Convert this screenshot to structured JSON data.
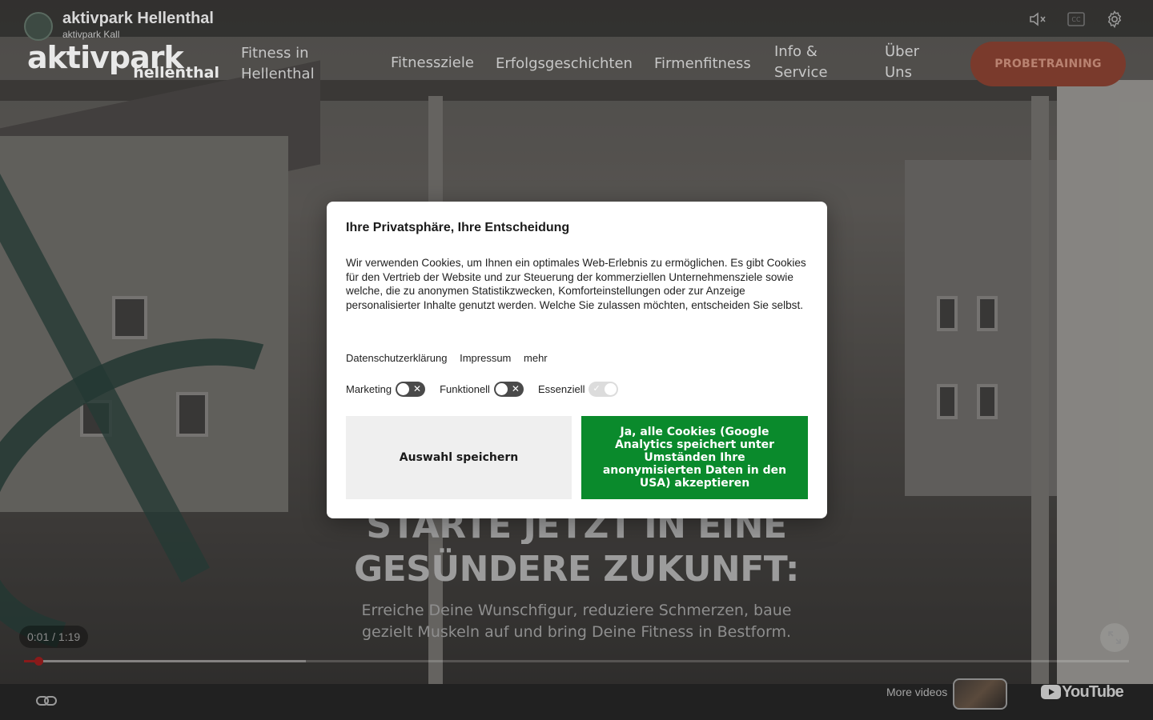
{
  "youtube": {
    "video_title": "aktivpark Hellenthal",
    "channel_name": "aktivpark Kall",
    "time_current": "0:01",
    "time_separator": "/",
    "time_total": "1:19",
    "progress_fraction": 0.013,
    "buffered_fraction": 0.255,
    "more_videos_label": "More videos",
    "logo_text": "YouTube",
    "icons": [
      "mute-icon",
      "captions-icon",
      "settings-icon",
      "expand-icon",
      "link-icon",
      "youtube-logo-icon"
    ]
  },
  "site": {
    "logo_main": "aktivpark",
    "logo_sub": "hellenthal",
    "nav": [
      {
        "line1": "Fitness in",
        "line2": "Hellenthal"
      },
      {
        "line1": "Fitnessziele",
        "line2": ""
      },
      {
        "line1": "Erfolgsgeschichten",
        "line2": ""
      },
      {
        "line1": "Firmenfitness",
        "line2": ""
      },
      {
        "line1": "Info &",
        "line2": "Service"
      },
      {
        "line1": "Über",
        "line2": "Uns"
      }
    ],
    "cta_label": "PROBETRAINING",
    "hero_line1": "STARTE JETZT IN EINE",
    "hero_line2": "GESÜNDERE ZUKUNFT:",
    "hero_subtitle": "Erreiche Deine Wunschfigur, reduziere Schmerzen, baue gezielt Muskeln auf und bring Deine Fitness in Bestform.",
    "colors": {
      "cta_bg": "#7a3a2c",
      "cta_text": "#b98271"
    }
  },
  "cookie": {
    "title": "Ihre Privatsphäre, Ihre Entscheidung",
    "body": "Wir verwenden Cookies, um Ihnen ein optimales Web-Erlebnis zu ermöglichen. Es gibt Cookies für den Vertrieb der Website und zur Steuerung der kommerziellen Unternehmensziele sowie welche, die zu anonymen Statistikzwecken, Komforteinstellungen oder zur Anzeige personalisierter Inhalte genutzt werden. Welche Sie zulassen möchten, entscheiden Sie selbst.",
    "links": [
      "Datenschutzerklärung",
      "Impressum",
      "mehr"
    ],
    "toggles": [
      {
        "label": "Marketing",
        "state": "off"
      },
      {
        "label": "Funktionell",
        "state": "off"
      },
      {
        "label": "Essenziell",
        "state": "on-disabled"
      }
    ],
    "save_label": "Auswahl speichern",
    "accept_label": "Ja, alle Cookies (Google Analytics speichert unter Umständen Ihre anonymisierten Daten in den USA) akzeptieren",
    "colors": {
      "accept_bg": "#0a8a2c",
      "save_bg": "#efefef"
    }
  }
}
